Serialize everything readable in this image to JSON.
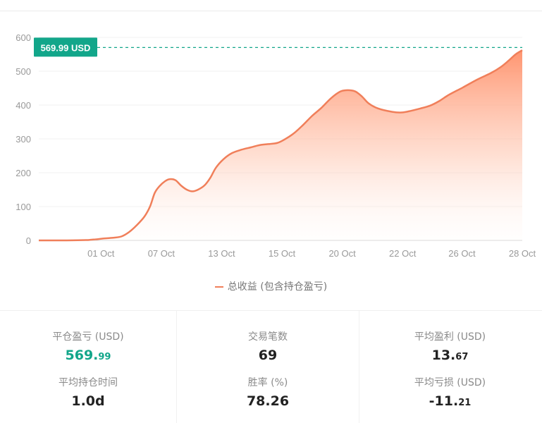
{
  "chart_data": {
    "type": "area",
    "series": [
      {
        "name": "总收益 (包含持仓盈亏)",
        "color": "#f07f5a",
        "points": [
          [
            0,
            0
          ],
          [
            3,
            0
          ],
          [
            5,
            1
          ],
          [
            6,
            3
          ],
          [
            7,
            6
          ],
          [
            8,
            8
          ],
          [
            8.8,
            12
          ],
          [
            9.6,
            25
          ],
          [
            10.4,
            45
          ],
          [
            11.2,
            70
          ],
          [
            11.8,
            100
          ],
          [
            12.3,
            140
          ],
          [
            12.8,
            160
          ],
          [
            13.4,
            175
          ],
          [
            13.9,
            181
          ],
          [
            14.5,
            178
          ],
          [
            15.1,
            162
          ],
          [
            15.7,
            150
          ],
          [
            16.3,
            145
          ],
          [
            16.9,
            150
          ],
          [
            17.6,
            163
          ],
          [
            18.2,
            185
          ],
          [
            18.8,
            215
          ],
          [
            19.6,
            240
          ],
          [
            20.5,
            258
          ],
          [
            21.5,
            268
          ],
          [
            22.5,
            275
          ],
          [
            23.5,
            282
          ],
          [
            24.5,
            285
          ],
          [
            25.3,
            288
          ],
          [
            26,
            297
          ],
          [
            27,
            315
          ],
          [
            28,
            340
          ],
          [
            29,
            368
          ],
          [
            30,
            392
          ],
          [
            31,
            420
          ],
          [
            32,
            440
          ],
          [
            32.8,
            444
          ],
          [
            33.6,
            440
          ],
          [
            34.3,
            425
          ],
          [
            35,
            405
          ],
          [
            36,
            390
          ],
          [
            37.5,
            380
          ],
          [
            38.5,
            378
          ],
          [
            39.5,
            383
          ],
          [
            40.5,
            390
          ],
          [
            41.5,
            398
          ],
          [
            42.5,
            412
          ],
          [
            43.5,
            430
          ],
          [
            45,
            452
          ],
          [
            46.5,
            475
          ],
          [
            48,
            495
          ],
          [
            49,
            512
          ],
          [
            49.8,
            530
          ],
          [
            50.6,
            550
          ],
          [
            51.4,
            562
          ],
          [
            52.2,
            568
          ],
          [
            53.5,
            569.99
          ],
          [
            55,
            569.99
          ]
        ]
      }
    ],
    "x_tick_labels": [
      "01 Oct",
      "07 Oct",
      "13 Oct",
      "15 Oct",
      "20 Oct",
      "22 Oct",
      "26 Oct",
      "28 Oct"
    ],
    "x_tick_positions": [
      6.6,
      13.0,
      19.4,
      25.8,
      32.2,
      38.6,
      44.9,
      51.3
    ],
    "xlim": [
      0,
      51.3
    ],
    "yticks": [
      0,
      100,
      200,
      300,
      400,
      500,
      600
    ],
    "ylim": [
      0,
      600
    ],
    "grid": true,
    "max_marker": {
      "value": 569.99,
      "label": "569.99 USD",
      "color": "#12a68a"
    },
    "legend": {
      "placement": "bottom",
      "label": "总收益 (包含持仓盈亏)"
    }
  },
  "stats": {
    "closed_pnl": {
      "label": "平仓盈亏 (USD)",
      "int": "569.",
      "dec": "99"
    },
    "avg_hold_time": {
      "label": "平均持仓时间",
      "value": "1.0d"
    },
    "trade_count": {
      "label": "交易笔数",
      "value": "69"
    },
    "win_rate": {
      "label": "胜率 (%)",
      "value": "78.26"
    },
    "avg_profit": {
      "label": "平均盈利 (USD)",
      "int": "13.",
      "dec": "67"
    },
    "avg_loss": {
      "label": "平均亏损 (USD)",
      "int": "-11.",
      "dec": "21"
    }
  }
}
